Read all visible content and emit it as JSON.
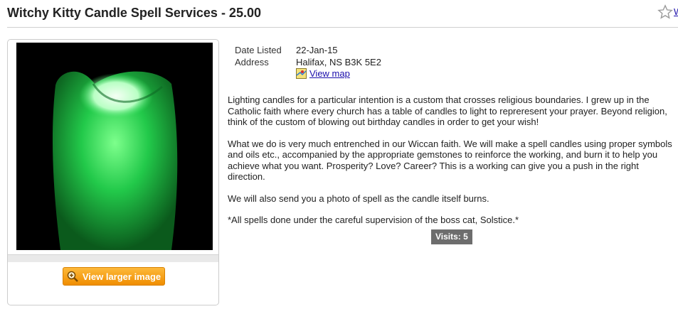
{
  "listing": {
    "title": "Witchy Kitty Candle Spell Services - 25.00",
    "watch_label": "W"
  },
  "details": {
    "date_label": "Date Listed",
    "date_value": "22-Jan-15",
    "address_label": "Address",
    "address_value": "Halifax, NS B3K 5E2",
    "map_link": "View map"
  },
  "photo": {
    "enlarge_label": "View larger image",
    "candle_color": "#22c94a"
  },
  "description": [
    "Lighting candles for a particular intention is a custom that crosses religious boundaries. I grew up in the Catholic faith where every church has a table of candles to light to repreresent your prayer. Beyond religion, think of the custom of blowing out birthday candles in order to get your wish!",
    "What we do is very much entrenched in our Wiccan faith. We will make a spell candles using proper symbols and oils etc., accompanied by the appropriate gemstones to reinforce the working, and burn it to help you achieve what you want. Prosperity? Love? Career? This is a working can give you a push in the right direction.",
    "We will also send you a photo of spell as the candle itself burns.",
    "*All spells done under the careful supervision of the boss cat, Solstice.*"
  ],
  "visits": "Visits: 5",
  "colors": {
    "accent_button": "#f5a623",
    "link": "#1a0dab",
    "visits_badge": "#6d6d6d"
  }
}
